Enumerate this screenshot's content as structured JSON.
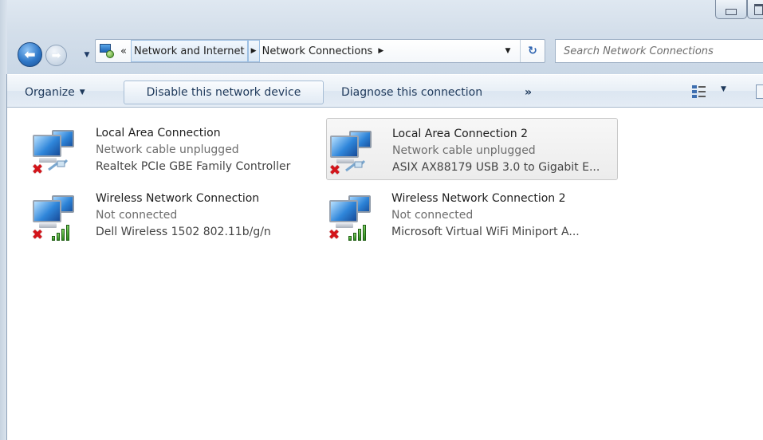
{
  "window": {
    "minimize_label": "",
    "maximize_label": ""
  },
  "nav": {
    "back_icon": "back-arrow-icon",
    "forward_icon": "forward-arrow-icon",
    "history_dropdown_icon": "chevron-down-icon",
    "back_glyph": "⬅",
    "forward_glyph": "➡",
    "history_glyph": "▼"
  },
  "address": {
    "overflow": "«",
    "crumbs": [
      {
        "label": "Network and Internet",
        "active": true
      },
      {
        "label": "Network Connections",
        "active": false
      }
    ],
    "separator_glyph": "▶",
    "dropdown_glyph": "▼",
    "refresh_glyph": "↻"
  },
  "search": {
    "placeholder": "Search Network Connections"
  },
  "commands": {
    "organize": "Organize",
    "organize_arrow": "▼",
    "disable": "Disable this network device",
    "diagnose": "Diagnose this connection",
    "more": "»",
    "views_arrow": "▼"
  },
  "connections": [
    {
      "name": "Local Area Connection",
      "status": "Network cable unplugged",
      "device": "Realtek PCIe GBE Family Controller",
      "type": "wired",
      "selected": false
    },
    {
      "name": "Local Area Connection 2",
      "status": "Network cable unplugged",
      "device": "ASIX AX88179 USB 3.0 to Gigabit E...",
      "type": "wired",
      "selected": true
    },
    {
      "name": "Wireless Network Connection",
      "status": "Not connected",
      "device": "Dell Wireless 1502 802.11b/g/n",
      "type": "wireless",
      "selected": false
    },
    {
      "name": "Wireless Network Connection 2",
      "status": "Not connected",
      "device": "Microsoft Virtual WiFi Miniport A...",
      "type": "wireless",
      "selected": false
    }
  ],
  "icons": {
    "error": "✖"
  },
  "colors": {
    "error_red": "#d4141a",
    "signal_green": "#2c8a1c",
    "command_text": "#1e395b",
    "status_gray": "#6d6d6d"
  }
}
